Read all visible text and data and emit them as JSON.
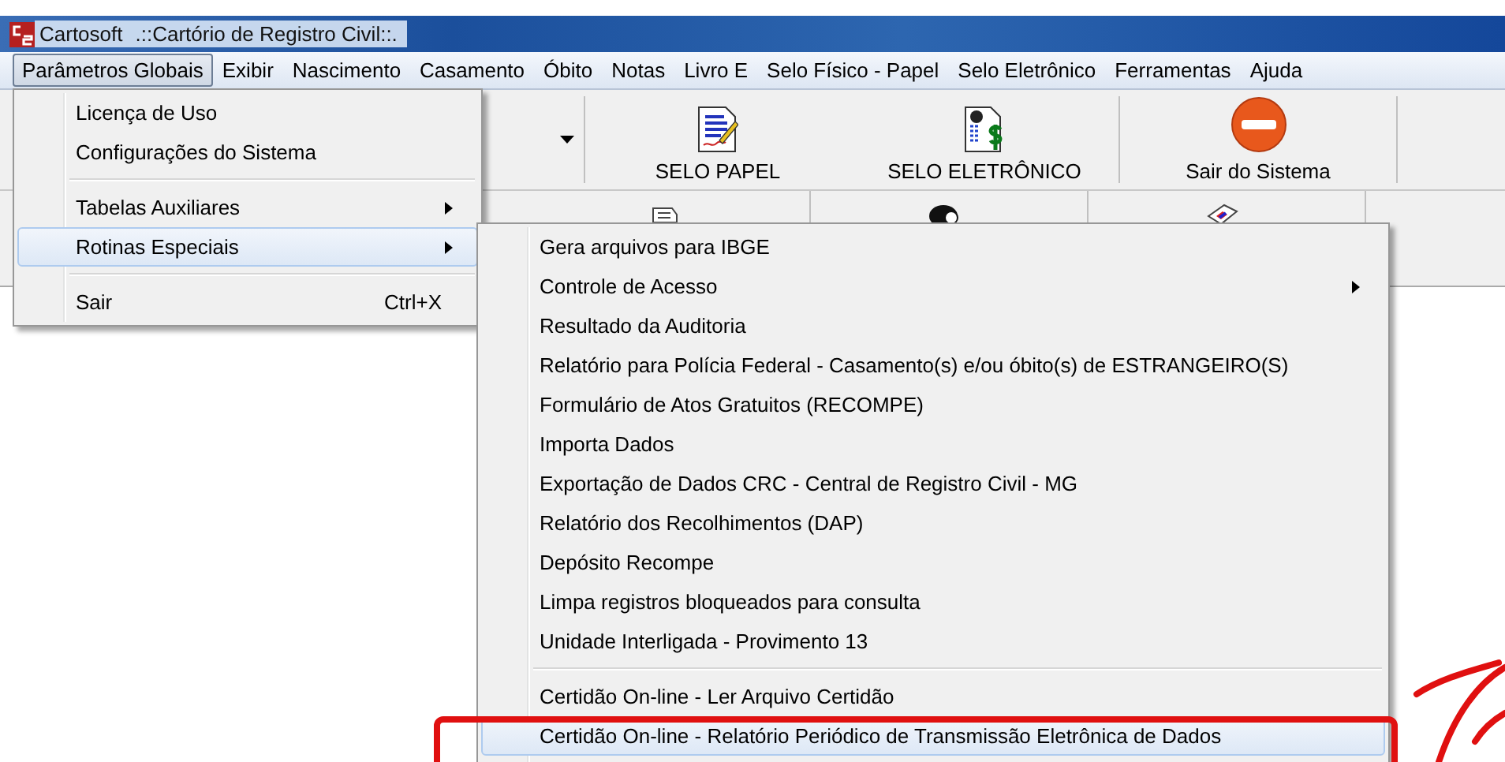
{
  "window": {
    "app_name": "Cartosoft",
    "title": ".::Cartório de Registro Civil::."
  },
  "menu_bar": [
    {
      "label": "Parâmetros Globais",
      "selected": true
    },
    {
      "label": "Exibir",
      "selected": false
    },
    {
      "label": "Nascimento",
      "selected": false
    },
    {
      "label": "Casamento",
      "selected": false
    },
    {
      "label": "Óbito",
      "selected": false
    },
    {
      "label": "Notas",
      "selected": false
    },
    {
      "label": "Livro E",
      "selected": false
    },
    {
      "label": "Selo Físico - Papel",
      "selected": false
    },
    {
      "label": "Selo Eletrônico",
      "selected": false
    },
    {
      "label": "Ferramentas",
      "selected": false
    },
    {
      "label": "Ajuda",
      "selected": false
    }
  ],
  "toolbar": {
    "buttons": [
      {
        "label": "SELO PAPEL",
        "kind": "paper"
      },
      {
        "label": "SELO ELETRÔNICO",
        "kind": "electronic"
      },
      {
        "label": "Sair do Sistema",
        "kind": "exit"
      }
    ]
  },
  "menu": {
    "items": [
      {
        "kind": "item",
        "label": "Licença de Uso",
        "submenu": false,
        "selected": false
      },
      {
        "kind": "item",
        "label": "Configurações do Sistema",
        "submenu": false,
        "selected": false
      },
      {
        "kind": "separator"
      },
      {
        "kind": "item",
        "label": "Tabelas Auxiliares",
        "submenu": true,
        "selected": false
      },
      {
        "kind": "item",
        "label": "Rotinas Especiais",
        "submenu": true,
        "selected": true
      },
      {
        "kind": "separator"
      },
      {
        "kind": "item",
        "label": "Sair",
        "shortcut": "Ctrl+X",
        "submenu": false,
        "selected": false
      }
    ]
  },
  "submenu": {
    "items": [
      {
        "kind": "item",
        "label": "Gera arquivos para IBGE",
        "submenu": false,
        "selected": false
      },
      {
        "kind": "item",
        "label": "Controle de Acesso",
        "submenu": true,
        "selected": false
      },
      {
        "kind": "item",
        "label": "Resultado da Auditoria",
        "submenu": false,
        "selected": false
      },
      {
        "kind": "item",
        "label": "Relatório para Polícia Federal - Casamento(s) e/ou óbito(s) de ESTRANGEIRO(S)",
        "submenu": false,
        "selected": false
      },
      {
        "kind": "item",
        "label": "Formulário de Atos Gratuitos (RECOMPE)",
        "submenu": false,
        "selected": false
      },
      {
        "kind": "item",
        "label": "Importa Dados",
        "submenu": false,
        "selected": false
      },
      {
        "kind": "item",
        "label": "Exportação de Dados CRC - Central de Registro Civil - MG",
        "submenu": false,
        "selected": false
      },
      {
        "kind": "item",
        "label": "Relatório dos Recolhimentos (DAP)",
        "submenu": false,
        "selected": false
      },
      {
        "kind": "item",
        "label": "Depósito Recompe",
        "submenu": false,
        "selected": false
      },
      {
        "kind": "item",
        "label": "Limpa registros bloqueados para consulta",
        "submenu": false,
        "selected": false
      },
      {
        "kind": "item",
        "label": "Unidade Interligada - Provimento 13",
        "submenu": false,
        "selected": false
      },
      {
        "kind": "separator"
      },
      {
        "kind": "item",
        "label": "Certidão On-line - Ler Arquivo Certidão",
        "submenu": false,
        "selected": false
      },
      {
        "kind": "item",
        "label": "Certidão On-line - Relatório Periódico de Transmissão Eletrônica de Dados",
        "submenu": false,
        "selected": true
      }
    ]
  }
}
